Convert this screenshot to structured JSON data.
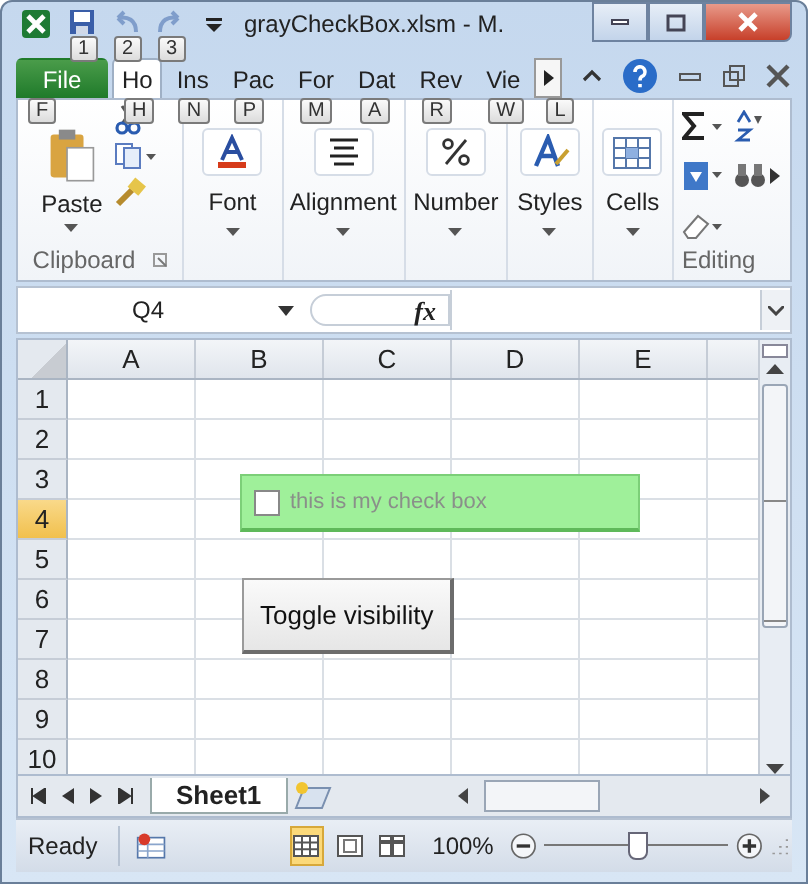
{
  "title_bar": {
    "title": "grayCheckBox.xlsm  -  M.",
    "quick_access": [
      {
        "kind": "save",
        "key_tip": "1",
        "disabled": false
      },
      {
        "kind": "undo",
        "key_tip": "2",
        "disabled": true
      },
      {
        "kind": "redo",
        "key_tip": "3",
        "disabled": true
      }
    ]
  },
  "ribbon_tabs": [
    {
      "label": "File",
      "kind": "file",
      "selected": false,
      "key_tip": "F"
    },
    {
      "label": "Ho",
      "kind": "tab",
      "selected": true,
      "key_tip": "H"
    },
    {
      "label": "Ins",
      "kind": "tab",
      "selected": false,
      "key_tip": "N"
    },
    {
      "label": "Pac",
      "kind": "tab",
      "selected": false,
      "key_tip": "P"
    },
    {
      "label": "For",
      "kind": "tab",
      "selected": false,
      "key_tip": "M"
    },
    {
      "label": "Dat",
      "kind": "tab",
      "selected": false,
      "key_tip": "A"
    },
    {
      "label": "Rev",
      "kind": "tab",
      "selected": false,
      "key_tip": "R"
    },
    {
      "label": "Vie",
      "kind": "tab",
      "selected": false,
      "key_tip": "W"
    }
  ],
  "more_tabs_key_tip": "L",
  "ribbon_groups": [
    {
      "kind": "clipboard",
      "button": "Paste",
      "label": "Clipboard"
    },
    {
      "kind": "font",
      "button": "Font"
    },
    {
      "kind": "alignment",
      "button": "Alignment"
    },
    {
      "kind": "number",
      "button": "Number"
    },
    {
      "kind": "styles",
      "button": "Styles"
    },
    {
      "kind": "cells",
      "button": "Cells"
    },
    {
      "kind": "editing",
      "label": "Editing"
    }
  ],
  "formula_bar": {
    "name_box": "Q4",
    "function_label": "fx"
  },
  "sheet": {
    "columns": [
      {
        "label": "A",
        "selected": false
      },
      {
        "label": "B",
        "selected": false
      },
      {
        "label": "C",
        "selected": false
      },
      {
        "label": "D",
        "selected": false
      },
      {
        "label": "E",
        "selected": false
      }
    ],
    "rows": [
      {
        "label": "1",
        "selected": false
      },
      {
        "label": "2",
        "selected": false
      },
      {
        "label": "3",
        "selected": false
      },
      {
        "label": "4",
        "selected": true
      },
      {
        "label": "5",
        "selected": false
      },
      {
        "label": "6",
        "selected": false
      },
      {
        "label": "7",
        "selected": false
      },
      {
        "label": "8",
        "selected": false
      },
      {
        "label": "9",
        "selected": false
      },
      {
        "label": "10",
        "selected": false
      }
    ],
    "checkbox": {
      "label": "this is my check box",
      "checked": false,
      "disabled": true
    },
    "button": {
      "label": "Toggle visibility"
    }
  },
  "sheet_tabs": [
    {
      "label": "Sheet1",
      "selected": true
    }
  ],
  "status_bar": {
    "status": "Ready",
    "views": [
      {
        "kind": "normal",
        "selected": true
      },
      {
        "kind": "page_layout",
        "selected": false
      },
      {
        "kind": "page_break",
        "selected": false
      }
    ],
    "zoom": "100%",
    "zoom_slider": {
      "level": 0.5
    }
  }
}
